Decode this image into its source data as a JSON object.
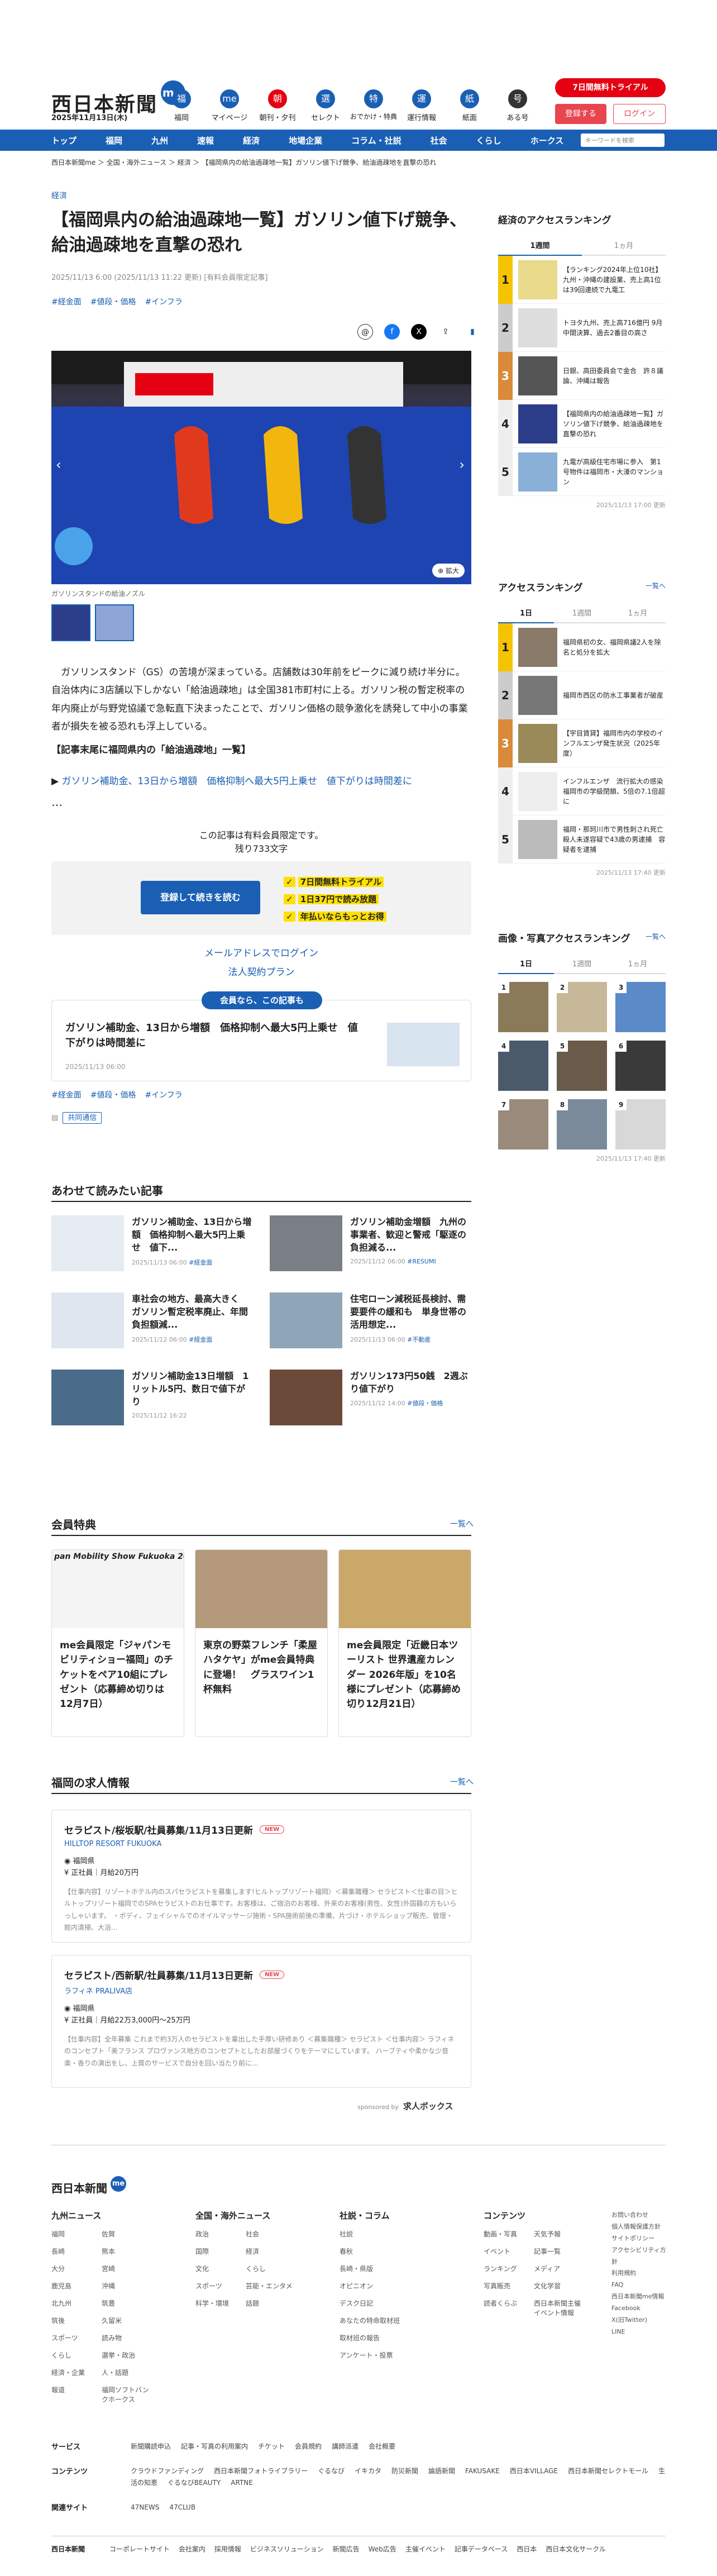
{
  "header": {
    "logo": "西日本新聞",
    "me": "me",
    "date": "2025年11月13日(木)",
    "trial": "7日間無料トライアル",
    "register": "登録する",
    "login": "ログイン",
    "nav": [
      {
        "label": "福岡",
        "icon": "福"
      },
      {
        "label": "マイページ",
        "icon": "me"
      },
      {
        "label": "朝刊・夕刊",
        "icon": "朝"
      },
      {
        "label": "セレクト",
        "icon": "選"
      },
      {
        "label": "おでかけ・特典",
        "icon": "特"
      },
      {
        "label": "運行情報",
        "icon": "運"
      },
      {
        "label": "紙面",
        "icon": "紙"
      },
      {
        "label": "ある号",
        "icon": "号"
      }
    ]
  },
  "gnav": {
    "items": [
      "トップ",
      "福岡",
      "九州",
      "速報",
      "経済",
      "地場企業",
      "コラム・社説",
      "社会",
      "くらし",
      "ホークス"
    ],
    "search": "キーワードを検索"
  },
  "breadcrumb": "西日本新聞me ＞ 全国・海外ニュース ＞ 経済 ＞ 【福岡県内の給油過疎地一覧】ガソリン値下げ競争、給油過疎地を直撃の恐れ",
  "article": {
    "category": "経済",
    "title": "【福岡県内の給油過疎地一覧】ガソリン値下げ競争、給油過疎地を直撃の恐れ",
    "meta": "2025/11/13 6:00 (2025/11/13 11:22 更新) [有料会員限定記事]",
    "tags": [
      "#経金面",
      "#値段・価格",
      "#インフラ"
    ],
    "caption": "ガソリンスタンドの給油ノズル",
    "enlarge": "拡大",
    "body": "ガソリンスタンド（GS）の苦境が深まっている。店舗数は30年前をピークに減り続け半分に。自治体内に3店舗以下しかない「給油過疎地」は全国381市町村に上る。ガソリン税の暫定税率の年内廃止が与野党協議で急転直下決まったことで、ガソリン価格の競争激化を誘発して中小の事業者が損失を被る恐れも浮上している。",
    "note": "【記事末尾に福岡県内の「給油過疎地」一覧】",
    "related": "ガソリン補助金、13日から増額　価格抑制へ最大5円上乗せ　値下がりは時間差に",
    "dots": "…",
    "paywall1": "この記事は有料会員限定です。",
    "paywall2": "残り733文字",
    "cta": "登録して続きを読む",
    "benefits": [
      "7日間無料トライアル",
      "1日37円で読み放題",
      "年払いならもっとお得"
    ],
    "maillogin": "メールアドレスでログイン",
    "corp": "法人契約プラン",
    "member_pill": "会員なら、この記事も",
    "member_title": "ガソリン補助金、13日から増額　価格抑制へ最大5円上乗せ　値下がりは時間差に",
    "member_date": "2025/11/13 06:00",
    "tags2": [
      "#経金面",
      "#値段・価格",
      "#インフラ"
    ],
    "keyword": "共同通信"
  },
  "recommend": {
    "title": "あわせて読みたい記事",
    "items": [
      {
        "t": "ガソリン補助金、13日から増額　価格抑制へ最大5円上乗せ　値下...",
        "d": "2025/11/13 06:00",
        "tag": "#経金面"
      },
      {
        "t": "ガソリン補助金増額　九州の事業者、歓迎と警戒「駆逐の負担減る...",
        "d": "2025/11/12 06:00",
        "tag": "#RESUMI"
      },
      {
        "t": "車社会の地方、最高大きく　ガソリン暫定税率廃止、年間負担額減...",
        "d": "2025/11/12 06:00",
        "tag": "#経金面"
      },
      {
        "t": "住宅ローン減税延長検討、需要要件の緩和も　単身世帯の活用想定...",
        "d": "2025/11/13 06:00",
        "tag": "#不動産"
      },
      {
        "t": "ガソリン補助金13日増額　1リットル5円、数日で値下がり",
        "d": "2025/11/12 16:22",
        "tag": ""
      },
      {
        "t": "ガソリン173円50銭　2週ぶり値下がり",
        "d": "2025/11/12 14:00",
        "tag": "#値段・価格"
      }
    ]
  },
  "benefits_sec": {
    "title": "会員特典",
    "more": "一覧へ",
    "items": [
      "me会員限定「ジャパンモビリティショー福岡」のチケットをペア10組にプレゼント（応募締め切りは12月7日）",
      "東京の野菜フレンチ「柔屋ハタケヤ」がme会員特典に登場！　グラスワイン1杯無料",
      "me会員限定「近畿日本ツーリスト 世界遺産カレンダー 2026年版」を10名様にプレゼント（応募締め切り12月21日）"
    ],
    "banner": "pan Mobility Show Fukuoka 20"
  },
  "jobs": {
    "title": "福岡の求人情報",
    "more": "一覧へ",
    "items": [
      {
        "t": "セラピスト/桜坂駅/社員募集/11月13日更新",
        "new": "NEW",
        "co": "HILLTOP RESORT FUKUOKA",
        "loc": "福岡県",
        "pay": "正社員｜月給20万円",
        "desc": "【仕事内容】リゾートホテル内のスパセラピストを募集します!ヒルトップリゾート福岡〉＜募集職種＞ セラピスト＜仕事の目＞ヒルトップリゾート福岡でのSPAセラピストのお仕事です。お客様は、ご宿泊のお客様、外来のお客様(男性、女性)外国籍の方もいらっしゃいます。 ・ボディ、フェイシャルでのオイルマッサージ施術・SPA施術前後の準備、片づけ・ホテルショップ販売、管理・館内清掃、大浴..."
      },
      {
        "t": "セラピスト/西新駅/社員募集/11月13日更新",
        "new": "NEW",
        "co": "ラフィネ PRALIVA店",
        "loc": "福岡県",
        "pay": "正社員｜月給22万3,000円〜25万円",
        "desc": "【仕事内容】全年募集 これまで約3万人のセラピストを輩出した手厚い研修あり ＜募集職種＞ セラピスト ＜仕事内容＞ ラフィネのコンセプト「美フランス プロヴァンス地方のコンセプトとしたお部屋づくりをテーマにしています。 ハーブティや柔かな少音楽・香りの演出をし、上質のサービスで自分を回い当たり前に..."
      }
    ],
    "sponsored": "sponsored by",
    "brand": "求人ボックス"
  },
  "sidebar": {
    "access_title": "経済のアクセスランキング",
    "tabs1": [
      "1週間",
      "1ヵ月"
    ],
    "rank1": [
      "【ランキング2024年上位10社】九州・沖縄の建設業、売上高1位は39回連続で九電工",
      "トヨタ九州、売上高716億円 9月中間決算、過去2番目の高さ",
      "日銀、高田委員会で金合　許８議論、沖縄は報告",
      "【福岡県内の給油過疎地一覧】ガソリン値下げ競争、給油過疎地を直撃の恐れ",
      "九電が高級住宅市場に参入　第1号物件は福岡市・大濠のマンション"
    ],
    "upd1": "2025/11/13 17:00 更新",
    "access2_title": "アクセスランキング",
    "more": "一覧へ",
    "tabs2": [
      "1日",
      "1週間",
      "1ヵ月"
    ],
    "rank2": [
      "福岡県初の女、福岡県議2人を除名と処分を拡大",
      "福岡市西区の防水工事業者が破産",
      "【宇目賃貸】福岡市内の学校のインフルエンザ発生状況（2025年度）",
      "インフルエンザ　流行拡大の感染　福岡市の学級閉鎖、5倍の7.1倍超に",
      "福岡・那珂川市で男性刺され死亡　殺人未遂容疑で43歳の男逮捕　容疑者を逮捕"
    ],
    "upd2": "2025/11/13 17:40 更新",
    "photo_title": "画像・写真アクセスランキング",
    "tabs3": [
      "1日",
      "1週間",
      "1ヵ月"
    ],
    "upd3": "2025/11/13 17:40 更新"
  },
  "footer": {
    "logo": "西日本新聞",
    "cols": [
      {
        "h": "九州ニュース",
        "items": [
          "福岡",
          "佐賀",
          "長崎",
          "熊本",
          "大分",
          "宮崎",
          "鹿児島",
          "沖縄",
          "北九州",
          "筑豊",
          "筑後",
          "久留米",
          "スポーツ",
          "読み物",
          "くらし",
          "選挙・政治",
          "経済・企業",
          "人・話題",
          "報道",
          "福岡ソフトバンクホークス"
        ]
      },
      {
        "h": "全国・海外ニュース",
        "items": [
          "政治",
          "社会",
          "国際",
          "経済",
          "文化",
          "くらし",
          "スポーツ",
          "芸能・エンタメ",
          "科学・環境",
          "話題"
        ]
      },
      {
        "h": "社説・コラム",
        "items": [
          "社説",
          "春秋",
          "長崎・県版",
          "オピニオン",
          "デスク日記",
          "あなたの特命取材班",
          "取材班の報告",
          "アンケート・投票"
        ]
      },
      {
        "h": "コンテンツ",
        "items": [
          "動画・写真",
          "天気予報",
          "イベント",
          "記事一覧",
          "ランキング",
          "メディア",
          "写真販売",
          "文化学習",
          "読者くらぶ",
          "西日本新聞主催イベント情報"
        ]
      }
    ],
    "side": [
      "お問い合わせ",
      "個人情報保護方針",
      "サイトポリシー",
      "アクセシビリティ方針",
      "利用規約",
      "FAQ",
      "西日本新聞me情報",
      "Facebook",
      "X(旧Twitter)",
      "LINE"
    ],
    "rows": [
      {
        "h": "サービス",
        "items": [
          "新聞購読申込",
          "記事・写真の利用案内",
          "チケット",
          "会員規約",
          "講師派遣",
          "会社概要"
        ]
      },
      {
        "h": "コンテンツ",
        "items": [
          "クラウドファンディング",
          "西日本新聞フォトライブラリー",
          "ぐるなび",
          "イキカタ",
          "防災新聞",
          "論語新聞",
          "FAKUSAKE",
          "西日本VILLAGE",
          "西日本新聞セレクトモール",
          "生活の知恵",
          "ぐるなびBEAUTY",
          "ARTNE"
        ]
      },
      {
        "h": "関連サイト",
        "items": [
          "47NEWS",
          "47CLUB"
        ]
      }
    ],
    "bottom": [
      "コーポレートサイト",
      "会社案内",
      "採用情報",
      "ビジネスソリューション",
      "新聞広告",
      "Web広告",
      "主催イベント",
      "記事データベース",
      "西日本",
      "西日本文化サークル"
    ]
  }
}
